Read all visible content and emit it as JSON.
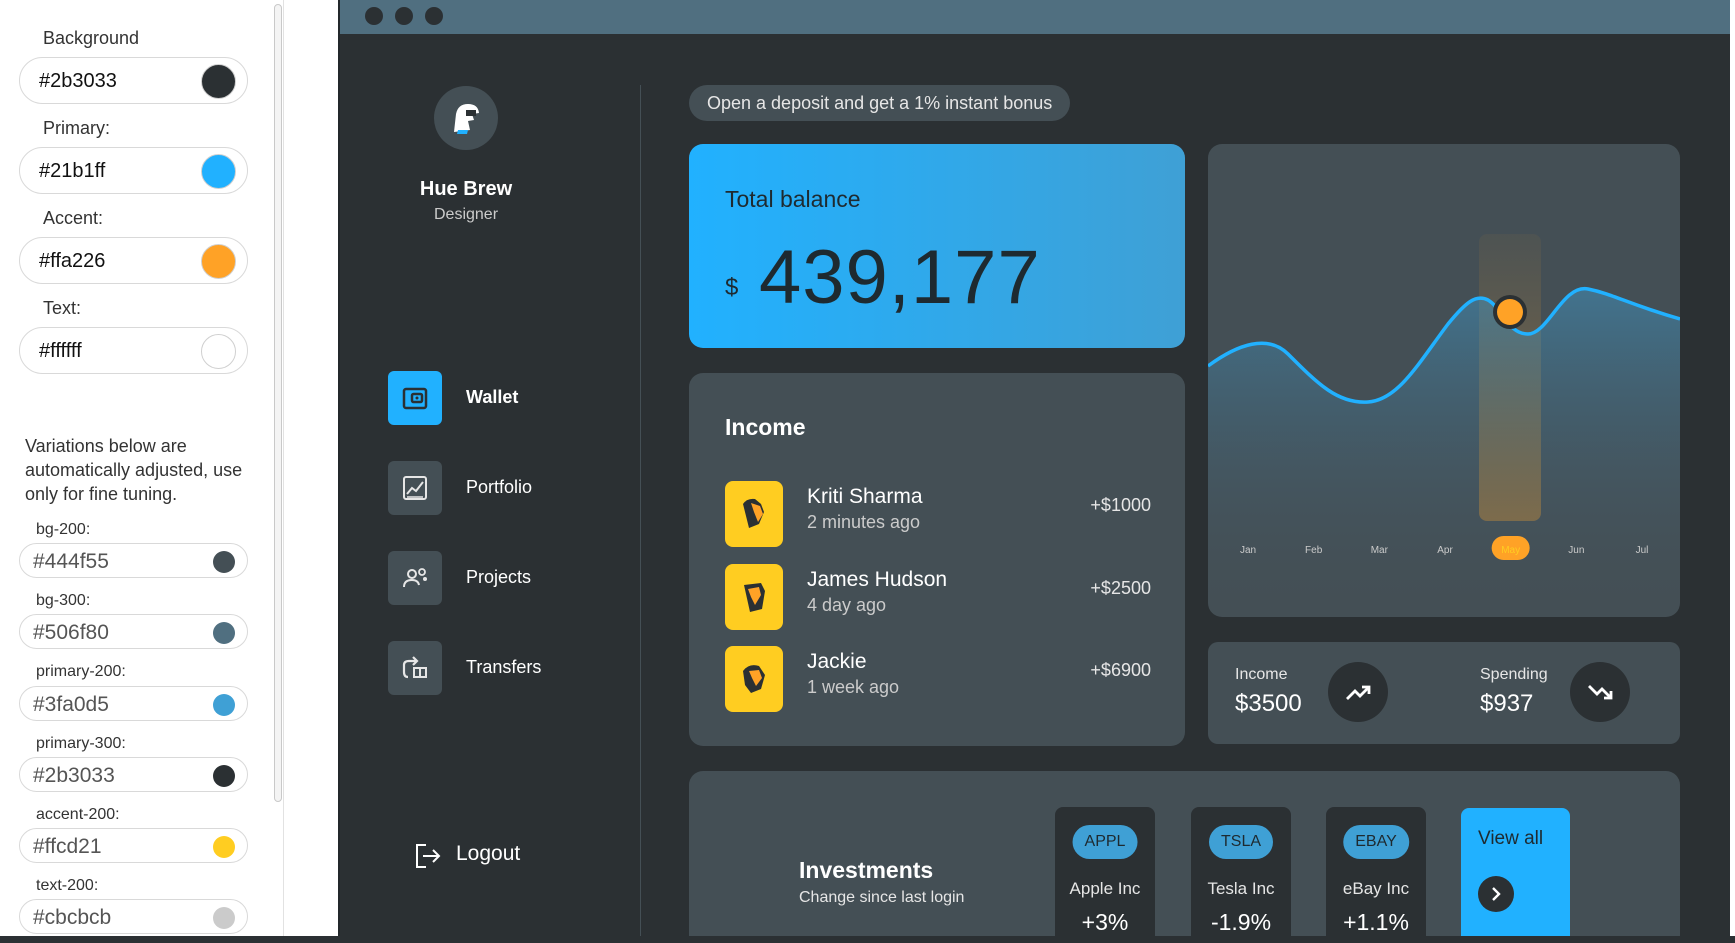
{
  "settings": {
    "main_colors": [
      {
        "label": "Background",
        "value": "#2b3033",
        "swatch": "#2b3033"
      },
      {
        "label": "Primary:",
        "value": "#21b1ff",
        "swatch": "#21b1ff"
      },
      {
        "label": "Accent:",
        "value": "#ffa226",
        "swatch": "#ffa226"
      },
      {
        "label": "Text:",
        "value": "#ffffff",
        "swatch": "#ffffff"
      }
    ],
    "note": "Variations below are automatically adjusted, use only for fine tuning.",
    "variations": [
      {
        "label": "bg-200:",
        "value": "#444f55",
        "swatch": "#444f55"
      },
      {
        "label": "bg-300:",
        "value": "#506f80",
        "swatch": "#506f80"
      },
      {
        "label": "primary-200:",
        "value": "#3fa0d5",
        "swatch": "#3fa0d5"
      },
      {
        "label": "primary-300:",
        "value": "#2b3033",
        "swatch": "#2b3033"
      },
      {
        "label": "accent-200:",
        "value": "#ffcd21",
        "swatch": "#ffcd21"
      },
      {
        "label": "text-200:",
        "value": "#cbcbcb",
        "swatch": "#cbcbcb"
      }
    ]
  },
  "profile": {
    "name": "Hue Brew",
    "role": "Designer"
  },
  "nav": [
    {
      "label": "Wallet",
      "icon": "wallet-icon",
      "active": true
    },
    {
      "label": "Portfolio",
      "icon": "chart-icon",
      "active": false
    },
    {
      "label": "Projects",
      "icon": "projects-icon",
      "active": false
    },
    {
      "label": "Transfers",
      "icon": "transfer-icon",
      "active": false
    }
  ],
  "logout_label": "Logout",
  "promo": "Open a deposit and get a 1% instant bonus",
  "balance": {
    "title": "Total balance",
    "currency": "$",
    "amount": "439,177"
  },
  "income": {
    "title": "Income",
    "rows": [
      {
        "name": "Kriti Sharma",
        "time": "2 minutes ago",
        "amount": "+$1000"
      },
      {
        "name": "James Hudson",
        "time": "4 day ago",
        "amount": "+$2500"
      },
      {
        "name": "Jackie",
        "time": "1 week ago",
        "amount": "+$6900"
      }
    ]
  },
  "chart_data": {
    "type": "line",
    "categories": [
      "Jan",
      "Feb",
      "Mar",
      "Apr",
      "May",
      "Jun",
      "Jul"
    ],
    "highlighted": "May",
    "line_color": "#21b1ff",
    "highlight_color": "#ffa226"
  },
  "stats": {
    "income_label": "Income",
    "income_value": "$3500",
    "spending_label": "Spending",
    "spending_value": "$937"
  },
  "investments": {
    "title": "Investments",
    "subtitle": "Change since last login",
    "stocks": [
      {
        "ticker": "APPL",
        "name": "Apple Inc",
        "change": "+3%"
      },
      {
        "ticker": "TSLA",
        "name": "Tesla Inc",
        "change": "-1.9%"
      },
      {
        "ticker": "EBAY",
        "name": "eBay Inc",
        "change": "+1.1%"
      }
    ],
    "view_all": "View all"
  }
}
